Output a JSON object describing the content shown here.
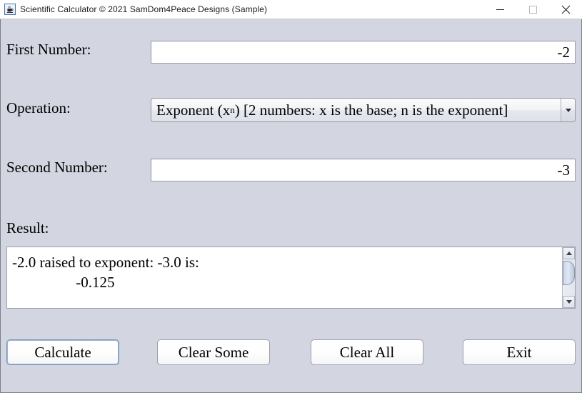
{
  "window": {
    "title": "Scientific Calculator © 2021 SamDom4Peace Designs (Sample)",
    "app_icon": "java-coffee-cup-icon",
    "controls": {
      "minimize": "minimize-icon",
      "maximize": "maximize-icon",
      "close": "close-icon"
    },
    "panel_bg": "#d3d6e0",
    "titlebar_bg": "#ffffff"
  },
  "form": {
    "first_number": {
      "label": "First Number:",
      "value": "-2",
      "placeholder": ""
    },
    "operation": {
      "label": "Operation:",
      "selected_prefix": "Exponent (x",
      "selected_superscript": "n",
      "selected_suffix": ") [2 numbers: x is the base; n is the exponent]",
      "selected_plain": "Exponent (x^n) [2 numbers: x is the base; n is the exponent]",
      "arrow_icon": "chevron-down-icon"
    },
    "second_number": {
      "label": "Second Number:",
      "value": "-3",
      "placeholder": ""
    },
    "result": {
      "label": "Result:",
      "line1": "-2.0 raised to exponent: -3.0 is:",
      "line2": "                 -0.125",
      "scrollbar": {
        "up_icon": "scroll-up-arrow-icon",
        "down_icon": "scroll-down-arrow-icon",
        "thumb": "scrollbar-thumb"
      }
    }
  },
  "buttons": {
    "calculate": "Calculate",
    "clear_some": "Clear Some",
    "clear_all": "Clear All",
    "exit": "Exit"
  }
}
